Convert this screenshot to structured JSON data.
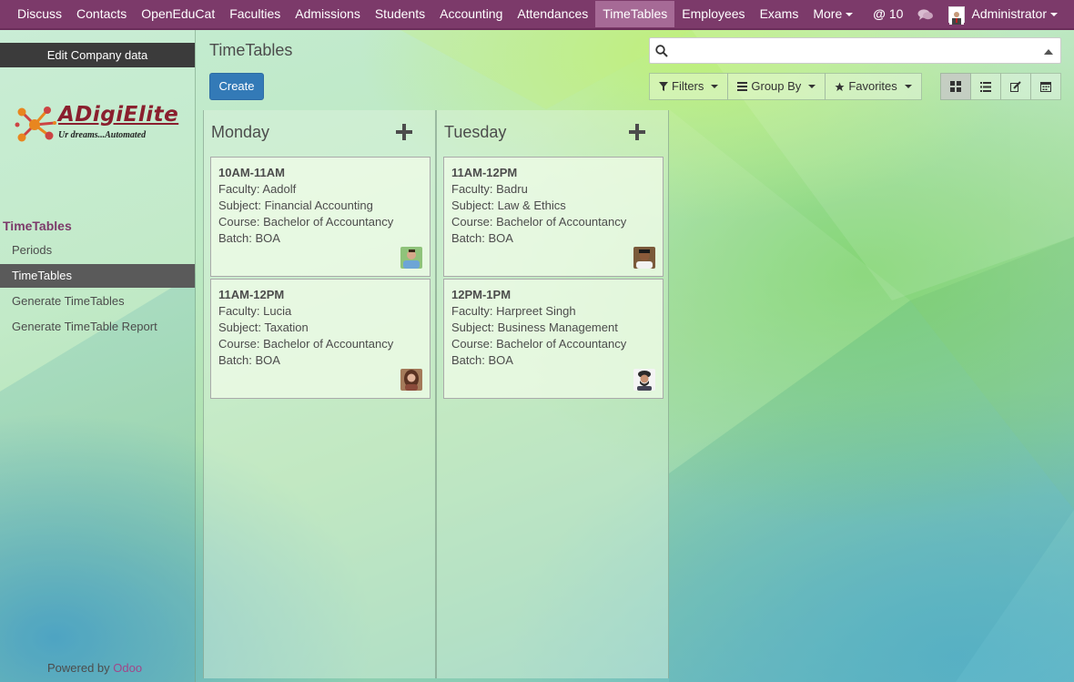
{
  "navbar": {
    "menus": [
      "Discuss",
      "Contacts",
      "OpenEduCat",
      "Faculties",
      "Admissions",
      "Students",
      "Accounting",
      "Attendances",
      "TimeTables",
      "Employees",
      "Exams"
    ],
    "active_menu": "TimeTables",
    "more_label": "More",
    "mentions_count": "10",
    "user_name": "Administrator",
    "brand_color": "#7c3a6a"
  },
  "sidebar": {
    "edit_company": "Edit Company data",
    "logo_title": "ADigiElite",
    "logo_tagline": "Ur dreams...Automated",
    "section": "TimeTables",
    "items": [
      "Periods",
      "TimeTables",
      "Generate TimeTables",
      "Generate TimeTable Report"
    ],
    "active_item": "TimeTables",
    "powered_by": "Powered by",
    "powered_brand": "Odoo"
  },
  "control_panel": {
    "title": "TimeTables",
    "create_label": "Create",
    "search_value": "",
    "filters_label": "Filters",
    "group_by_label": "Group By",
    "favorites_label": "Favorites",
    "active_view": "kanban"
  },
  "kanban": {
    "columns": [
      {
        "title": "Monday",
        "cards": [
          {
            "time": "10AM-11AM",
            "faculty": "Faculty: Aadolf",
            "subject": "Subject: Financial Accounting",
            "course": "Course: Bachelor of Accountancy",
            "batch": "Batch: BOA",
            "avatar": "faculty-avatar-aadolf"
          },
          {
            "time": "11AM-12PM",
            "faculty": "Faculty: Lucia",
            "subject": "Subject: Taxation",
            "course": "Course: Bachelor of Accountancy",
            "batch": "Batch: BOA",
            "avatar": "faculty-avatar-lucia"
          }
        ]
      },
      {
        "title": "Tuesday",
        "cards": [
          {
            "time": "11AM-12PM",
            "faculty": "Faculty: Badru",
            "subject": "Subject: Law & Ethics",
            "course": "Course: Bachelor of Accountancy",
            "batch": "Batch: BOA",
            "avatar": "faculty-avatar-badru"
          },
          {
            "time": "12PM-1PM",
            "faculty": "Faculty: Harpreet Singh",
            "subject": "Subject: Business Management",
            "course": "Course: Bachelor of Accountancy",
            "batch": "Batch: BOA",
            "avatar": "faculty-avatar-harpreet"
          }
        ]
      }
    ]
  }
}
